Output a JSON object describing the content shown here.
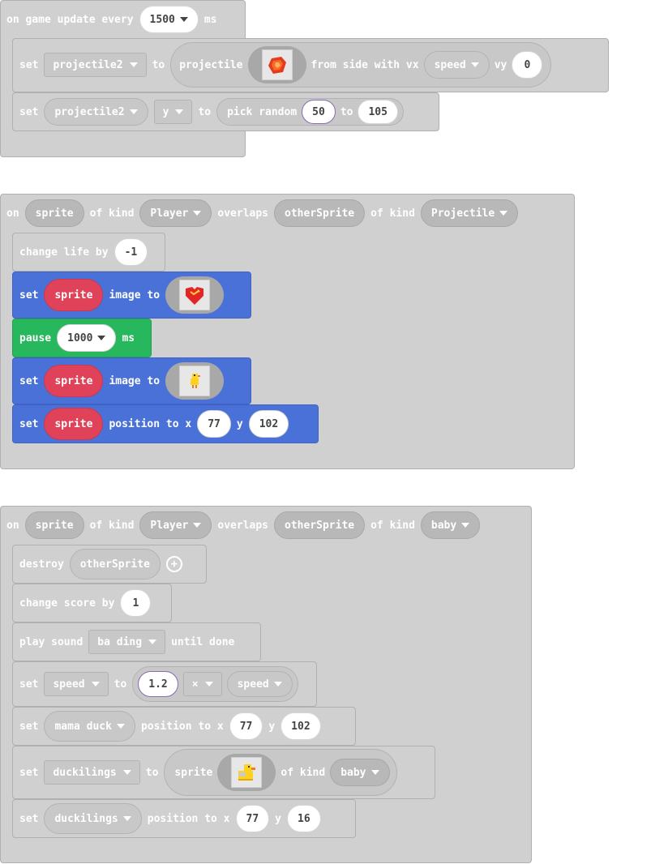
{
  "event1": {
    "hat": {
      "kw1": "on game update every",
      "interval": "1500",
      "unit": "ms"
    },
    "set_proj": {
      "set": "set",
      "var": "projectile2",
      "to": "to",
      "proj_kw": "projectile",
      "from_side": "from side with vx",
      "vx_var": "speed",
      "vy": "vy",
      "vy_val": "0"
    },
    "set_y": {
      "set": "set",
      "var": "projectile2",
      "prop": "y",
      "to": "to",
      "pick": "pick random",
      "min": "50",
      "to2": "to",
      "max": "105"
    }
  },
  "event2": {
    "hat": {
      "on": "on",
      "sprite": "sprite",
      "of_kind": "of kind",
      "kind1": "Player",
      "overlaps": "overlaps",
      "other": "otherSprite",
      "of_kind2": "of kind",
      "kind2": "Projectile"
    },
    "change_life": {
      "label": "change life by",
      "value": "-1"
    },
    "set_img1": {
      "set": "set",
      "sprite": "sprite",
      "image_to": "image to"
    },
    "pause": {
      "label": "pause",
      "value": "1000",
      "unit": "ms"
    },
    "set_img2": {
      "set": "set",
      "sprite": "sprite",
      "image_to": "image to"
    },
    "set_pos": {
      "set": "set",
      "sprite": "sprite",
      "position_to": "position to x",
      "x": "77",
      "y_label": "y",
      "y": "102"
    }
  },
  "event3": {
    "hat": {
      "on": "on",
      "sprite": "sprite",
      "of_kind": "of kind",
      "kind1": "Player",
      "overlaps": "overlaps",
      "other": "otherSprite",
      "of_kind2": "of kind",
      "kind2": "baby"
    },
    "destroy": {
      "label": "destroy",
      "var": "otherSprite"
    },
    "change_score": {
      "label": "change score by",
      "value": "1"
    },
    "play_sound": {
      "label": "play sound",
      "sound": "ba ding",
      "until": "until done"
    },
    "set_speed": {
      "set": "set",
      "var": "speed",
      "to": "to",
      "factor": "1.2",
      "op": "×",
      "rhs": "speed"
    },
    "set_mama": {
      "set": "set",
      "var": "mama duck",
      "position_to": "position to x",
      "x": "77",
      "y_label": "y",
      "y": "102"
    },
    "set_duck": {
      "set": "set",
      "var": "duckilings",
      "to": "to",
      "sprite_kw": "sprite",
      "of_kind": "of kind",
      "kind": "baby"
    },
    "set_duck_pos": {
      "set": "set",
      "var": "duckilings",
      "position_to": "position to x",
      "x": "77",
      "y_label": "y",
      "y": "16"
    }
  }
}
